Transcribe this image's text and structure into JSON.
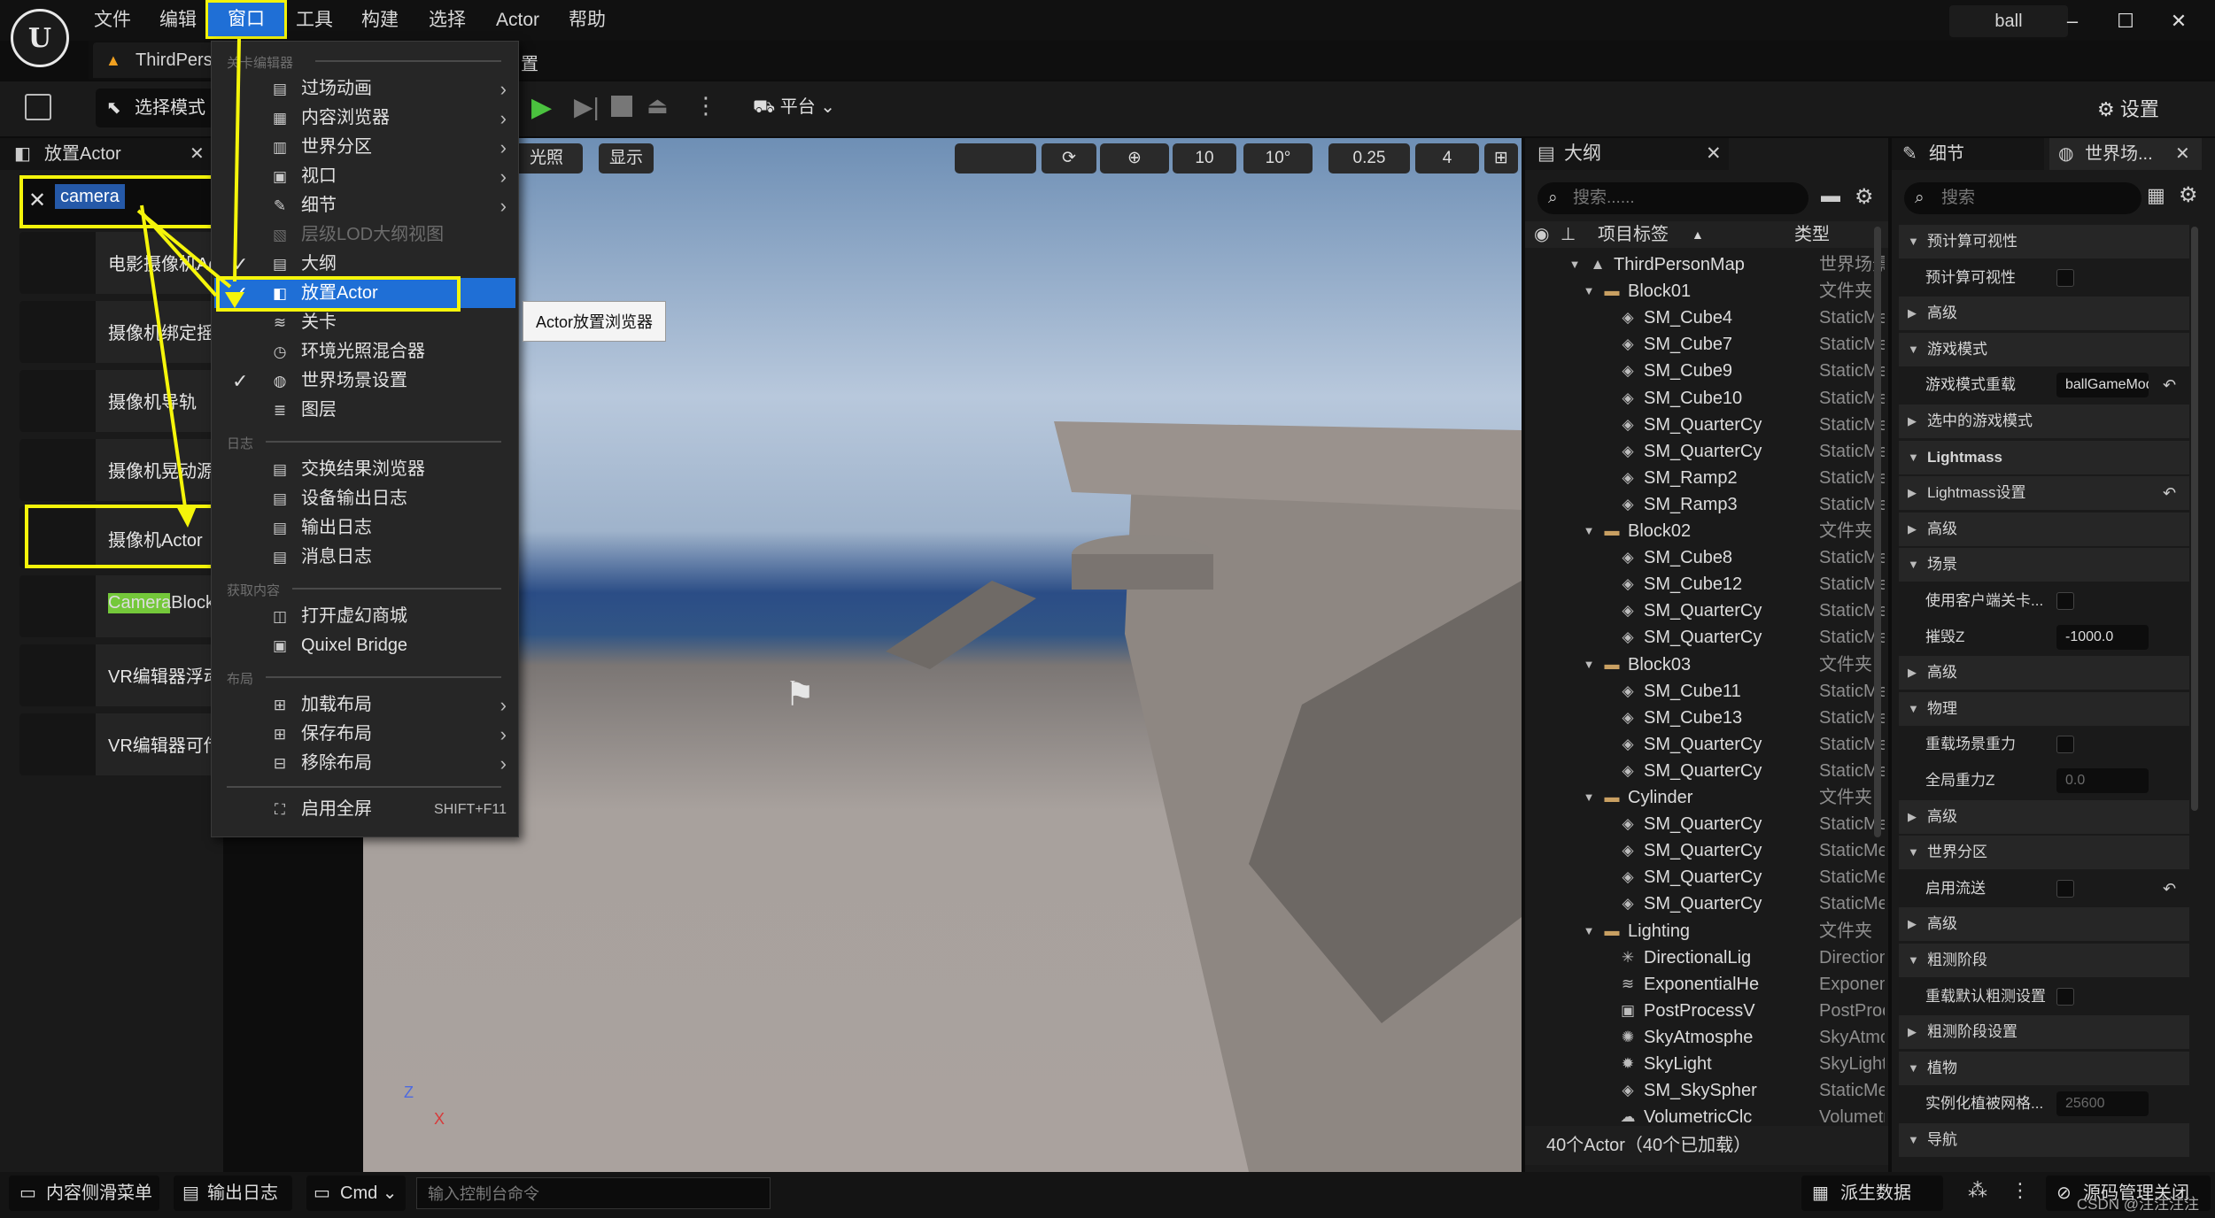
{
  "app": {
    "project_name": "ball",
    "level_tab": "ThirdPers",
    "level_tab_suffix": "置"
  },
  "menubar": [
    "文件",
    "编辑",
    "窗口",
    "工具",
    "构建",
    "选择",
    "Actor",
    "帮助"
  ],
  "toolbar": {
    "select_mode": "选择模式",
    "platform": "平台",
    "settings": "设置"
  },
  "place_actor": {
    "title": "放置Actor",
    "search_value": "camera",
    "items": [
      "电影摄像机Actor",
      "摄像机绑定摇臂",
      "摄像机导轨",
      "摄像机晃动源",
      "摄像机Actor",
      "CameraBlocking",
      "VR编辑器浮动UI",
      "VR编辑器可传送"
    ],
    "item_highlight": "Camera"
  },
  "viewport": {
    "lighting": "光照",
    "show": "显示",
    "grid_snap": "10",
    "rot_snap": "10°",
    "scale_snap": "0.25",
    "cam_speed": "4"
  },
  "window_menu": {
    "section_level_editor": "关卡编辑器",
    "section_log": "日志",
    "section_get_content": "获取内容",
    "section_layout": "布局",
    "items": [
      {
        "label": "过场动画",
        "icon": "cinematic-icon",
        "submenu": true
      },
      {
        "label": "内容浏览器",
        "icon": "content-browser-icon",
        "submenu": true
      },
      {
        "label": "世界分区",
        "icon": "world-partition-icon",
        "submenu": true
      },
      {
        "label": "视口",
        "icon": "viewport-icon",
        "submenu": true
      },
      {
        "label": "细节",
        "icon": "details-icon",
        "submenu": true
      },
      {
        "label": "层级LOD大纲视图",
        "icon": "hlod-icon",
        "disabled": true
      },
      {
        "label": "大纲",
        "icon": "outliner-icon",
        "checked": true
      },
      {
        "label": "放置Actor",
        "icon": "place-actor-icon",
        "checked": true,
        "selected": true
      },
      {
        "label": "关卡",
        "icon": "levels-icon"
      },
      {
        "label": "环境光照混合器",
        "icon": "env-light-icon"
      },
      {
        "label": "世界场景设置",
        "icon": "world-settings-icon",
        "checked": true
      },
      {
        "label": "图层",
        "icon": "layers-icon"
      }
    ],
    "log_items": [
      "交换结果浏览器",
      "设备输出日志",
      "输出日志",
      "消息日志"
    ],
    "content_items": [
      "打开虚幻商城",
      "Quixel Bridge"
    ],
    "layout_items": [
      "加载布局",
      "保存布局",
      "移除布局"
    ],
    "fullscreen": "启用全屏",
    "fullscreen_shortcut": "SHIFT+F11",
    "tooltip": "Actor放置浏览器"
  },
  "outliner": {
    "title": "大纲",
    "search_placeholder": "搜索......",
    "col_label": "项目标签",
    "col_type": "类型",
    "rows": [
      {
        "name": "ThirdPersonMap",
        "type": "世界场景",
        "indent": 1,
        "kind": "map"
      },
      {
        "name": "Block01",
        "type": "文件夹",
        "indent": 2,
        "kind": "folder"
      },
      {
        "name": "SM_Cube4",
        "type": "StaticMe",
        "indent": 3,
        "kind": "mesh"
      },
      {
        "name": "SM_Cube7",
        "type": "StaticMe",
        "indent": 3,
        "kind": "mesh"
      },
      {
        "name": "SM_Cube9",
        "type": "StaticMe",
        "indent": 3,
        "kind": "mesh"
      },
      {
        "name": "SM_Cube10",
        "type": "StaticMe",
        "indent": 3,
        "kind": "mesh"
      },
      {
        "name": "SM_QuarterCy",
        "type": "StaticMe",
        "indent": 3,
        "kind": "mesh"
      },
      {
        "name": "SM_QuarterCy",
        "type": "StaticMe",
        "indent": 3,
        "kind": "mesh"
      },
      {
        "name": "SM_Ramp2",
        "type": "StaticMe",
        "indent": 3,
        "kind": "mesh"
      },
      {
        "name": "SM_Ramp3",
        "type": "StaticMe",
        "indent": 3,
        "kind": "mesh"
      },
      {
        "name": "Block02",
        "type": "文件夹",
        "indent": 2,
        "kind": "folder"
      },
      {
        "name": "SM_Cube8",
        "type": "StaticMe",
        "indent": 3,
        "kind": "mesh"
      },
      {
        "name": "SM_Cube12",
        "type": "StaticMe",
        "indent": 3,
        "kind": "mesh"
      },
      {
        "name": "SM_QuarterCy",
        "type": "StaticMe",
        "indent": 3,
        "kind": "mesh"
      },
      {
        "name": "SM_QuarterCy",
        "type": "StaticMe",
        "indent": 3,
        "kind": "mesh"
      },
      {
        "name": "Block03",
        "type": "文件夹",
        "indent": 2,
        "kind": "folder"
      },
      {
        "name": "SM_Cube11",
        "type": "StaticMe",
        "indent": 3,
        "kind": "mesh"
      },
      {
        "name": "SM_Cube13",
        "type": "StaticMe",
        "indent": 3,
        "kind": "mesh"
      },
      {
        "name": "SM_QuarterCy",
        "type": "StaticMe",
        "indent": 3,
        "kind": "mesh"
      },
      {
        "name": "SM_QuarterCy",
        "type": "StaticMe",
        "indent": 3,
        "kind": "mesh"
      },
      {
        "name": "Cylinder",
        "type": "文件夹",
        "indent": 2,
        "kind": "folder"
      },
      {
        "name": "SM_QuarterCy",
        "type": "StaticMe",
        "indent": 3,
        "kind": "mesh"
      },
      {
        "name": "SM_QuarterCy",
        "type": "StaticMe",
        "indent": 3,
        "kind": "mesh"
      },
      {
        "name": "SM_QuarterCy",
        "type": "StaticMe",
        "indent": 3,
        "kind": "mesh"
      },
      {
        "name": "SM_QuarterCy",
        "type": "StaticMe",
        "indent": 3,
        "kind": "mesh"
      },
      {
        "name": "Lighting",
        "type": "文件夹",
        "indent": 2,
        "kind": "folder"
      },
      {
        "name": "DirectionalLig",
        "type": "Direction",
        "indent": 3,
        "kind": "light"
      },
      {
        "name": "ExponentialHe",
        "type": "Exponent",
        "indent": 3,
        "kind": "fog"
      },
      {
        "name": "PostProcessV",
        "type": "PostProc",
        "indent": 3,
        "kind": "post"
      },
      {
        "name": "SkyAtmosphe",
        "type": "SkyAtmo",
        "indent": 3,
        "kind": "sky"
      },
      {
        "name": "SkyLight",
        "type": "SkyLight",
        "indent": 3,
        "kind": "skylight"
      },
      {
        "name": "SM_SkySpher",
        "type": "StaticMe",
        "indent": 3,
        "kind": "mesh"
      },
      {
        "name": "VolumetricClc",
        "type": "Volumetr",
        "indent": 3,
        "kind": "cloud"
      }
    ],
    "footer": "40个Actor（40个已加载）"
  },
  "details": {
    "tab_details": "细节",
    "tab_world": "世界场...",
    "search_placeholder": "搜索",
    "rows": [
      {
        "label": "预计算可视性",
        "type": "cat",
        "expanded": true
      },
      {
        "label": "预计算可视性",
        "type": "check"
      },
      {
        "label": "高级",
        "type": "cat"
      },
      {
        "label": "游戏模式",
        "type": "cat",
        "expanded": true
      },
      {
        "label": "游戏模式重载",
        "type": "input",
        "value": "ballGameMode",
        "reset": true
      },
      {
        "label": "选中的游戏模式",
        "type": "cat"
      },
      {
        "label": "Lightmass",
        "type": "cat",
        "expanded": true,
        "bold": true
      },
      {
        "label": "Lightmass设置",
        "type": "cat",
        "reset": true
      },
      {
        "label": "高级",
        "type": "cat"
      },
      {
        "label": "场景",
        "type": "cat",
        "expanded": true
      },
      {
        "label": "使用客户端关卡...",
        "type": "check"
      },
      {
        "label": "摧毁Z",
        "type": "input",
        "value": "-1000.0"
      },
      {
        "label": "高级",
        "type": "cat"
      },
      {
        "label": "物理",
        "type": "cat",
        "expanded": true
      },
      {
        "label": "重载场景重力",
        "type": "check"
      },
      {
        "label": "全局重力Z",
        "type": "input",
        "value": "0.0",
        "disabled": true
      },
      {
        "label": "高级",
        "type": "cat"
      },
      {
        "label": "世界分区",
        "type": "cat",
        "expanded": true
      },
      {
        "label": "启用流送",
        "type": "check",
        "reset": true
      },
      {
        "label": "高级",
        "type": "cat"
      },
      {
        "label": "粗测阶段",
        "type": "cat",
        "expanded": true
      },
      {
        "label": "重载默认粗测设置",
        "type": "check"
      },
      {
        "label": "粗测阶段设置",
        "type": "cat"
      },
      {
        "label": "植物",
        "type": "cat",
        "expanded": true
      },
      {
        "label": "实例化植被网格...",
        "type": "input",
        "value": "25600",
        "disabled": true
      },
      {
        "label": "导航",
        "type": "cat",
        "expanded": true
      }
    ]
  },
  "bottombar": {
    "content_drawer": "内容侧滑菜单",
    "output_log": "输出日志",
    "cmd": "Cmd",
    "console_placeholder": "输入控制台命令",
    "derived_data": "派生数据",
    "source_control": "源码管理关闭",
    "watermark": "CSDN @注注注注"
  },
  "colors": {
    "accent": "#1f6fd6",
    "highlight": "#f5f50a",
    "panel": "#1a1a1a"
  }
}
